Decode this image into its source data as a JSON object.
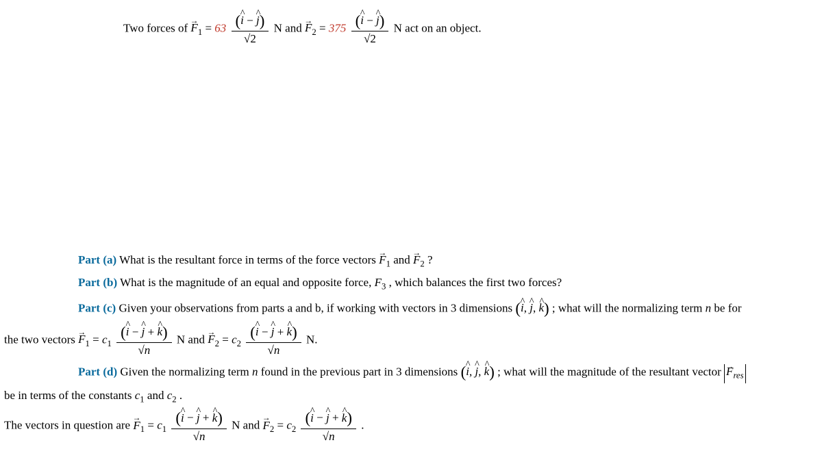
{
  "intro": {
    "prefix": "Two forces of ",
    "F1_label": "F",
    "F1_sub": "1",
    "eq": " = ",
    "F1_coef": "63",
    "unit_vec_2d_num_l": "(",
    "ihat": "i",
    "minus": " − ",
    "jhat": "j",
    "unit_vec_2d_num_r": ")",
    "sqrt2": "√2",
    "N_and": " N and ",
    "F2_label": "F",
    "F2_sub": "2",
    "F2_coef": "375",
    "N_act": " N act on an object."
  },
  "parts": {
    "a": {
      "label": "Part (a)",
      "text_1": "  What is the resultant force in terms of the force vectors ",
      "F1": "F",
      "F1s": "1",
      "and": " and ",
      "F2": "F",
      "F2s": "2",
      "q": "?"
    },
    "b": {
      "label": "Part (b)",
      "text_1": "  What is the magnitude of an equal and opposite force, ",
      "F3": "F",
      "F3s": "3",
      "text_2": ", which balances the first two forces?"
    },
    "c": {
      "label": "Part (c)",
      "text_1": "  Given your observations from parts a and b, if working with vectors in 3 dimensions ",
      "basis_l": "(",
      "ihat": "i",
      "comma1": ", ",
      "jhat": "j",
      "comma2": ", ",
      "khat": "k",
      "basis_r": ")",
      "text_2": "; what will the normalizing term ",
      "n_var": "n",
      "text_3": " be for",
      "line2_pre": "the two vectors ",
      "F1": "F",
      "F1s": "1",
      "eq": " = ",
      "c1": "c",
      "c1s": "1",
      "num_l": "(",
      "minus": " − ",
      "plus": " + ",
      "num_r": ")",
      "sqrtn": "√n",
      "Nand": " N and ",
      "F2": "F",
      "F2s": "2",
      "c2": "c",
      "c2s": "2",
      "Nend": " N."
    },
    "d": {
      "label": "Part (d)",
      "text_1": "  Given the normalizing term ",
      "n_var": "n",
      "text_2": " found in the previous part in 3 dimensions ",
      "basis_l": "(",
      "ihat": "i",
      "comma1": ", ",
      "jhat": "j",
      "comma2": ", ",
      "khat": "k",
      "basis_r": ")",
      "text_3": "; what will the magnitude of the resultant vector ",
      "Fres": "F",
      "Fres_sub": "res",
      "line2_pre": "be in terms of the constants ",
      "c1": "c",
      "c1s": "1",
      "and": " and ",
      "c2": "c",
      "c2s": "2",
      "period": ".",
      "line3_pre": "The vectors in question are ",
      "F1": "F",
      "F1s": "1",
      "eq": " = ",
      "num_l": "(",
      "minus": " − ",
      "plus": " + ",
      "num_r": ")",
      "sqrtn": "√n",
      "Nand": " N and ",
      "F2": "F",
      "F2s": "2",
      "end_period": " ."
    }
  }
}
